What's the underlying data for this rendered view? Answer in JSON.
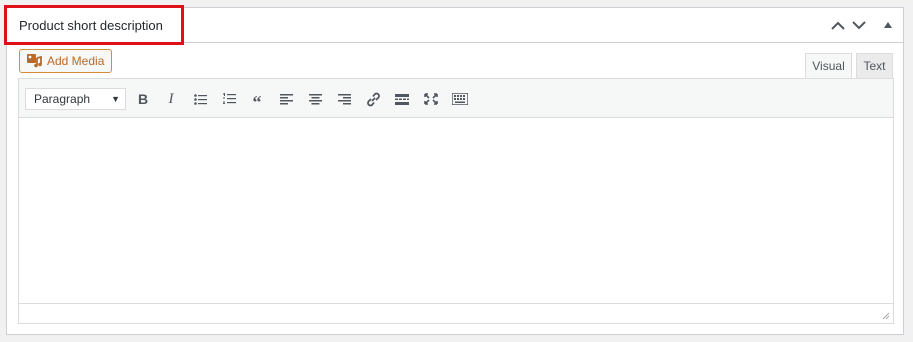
{
  "metabox": {
    "title": "Product short description",
    "highlight_color": "#e0101a",
    "controls": [
      "move-up",
      "move-down",
      "toggle-panel"
    ]
  },
  "editor": {
    "add_media_label": "Add Media",
    "tabs": [
      {
        "label": "Visual",
        "active": true
      },
      {
        "label": "Text",
        "active": false
      }
    ],
    "format_select": "Paragraph",
    "toolbar_buttons": [
      "bold",
      "italic",
      "bulleted-list",
      "numbered-list",
      "blockquote",
      "align-left",
      "align-center",
      "align-right",
      "insert-link",
      "read-more",
      "fullscreen",
      "toolbar-toggle"
    ],
    "content": ""
  }
}
